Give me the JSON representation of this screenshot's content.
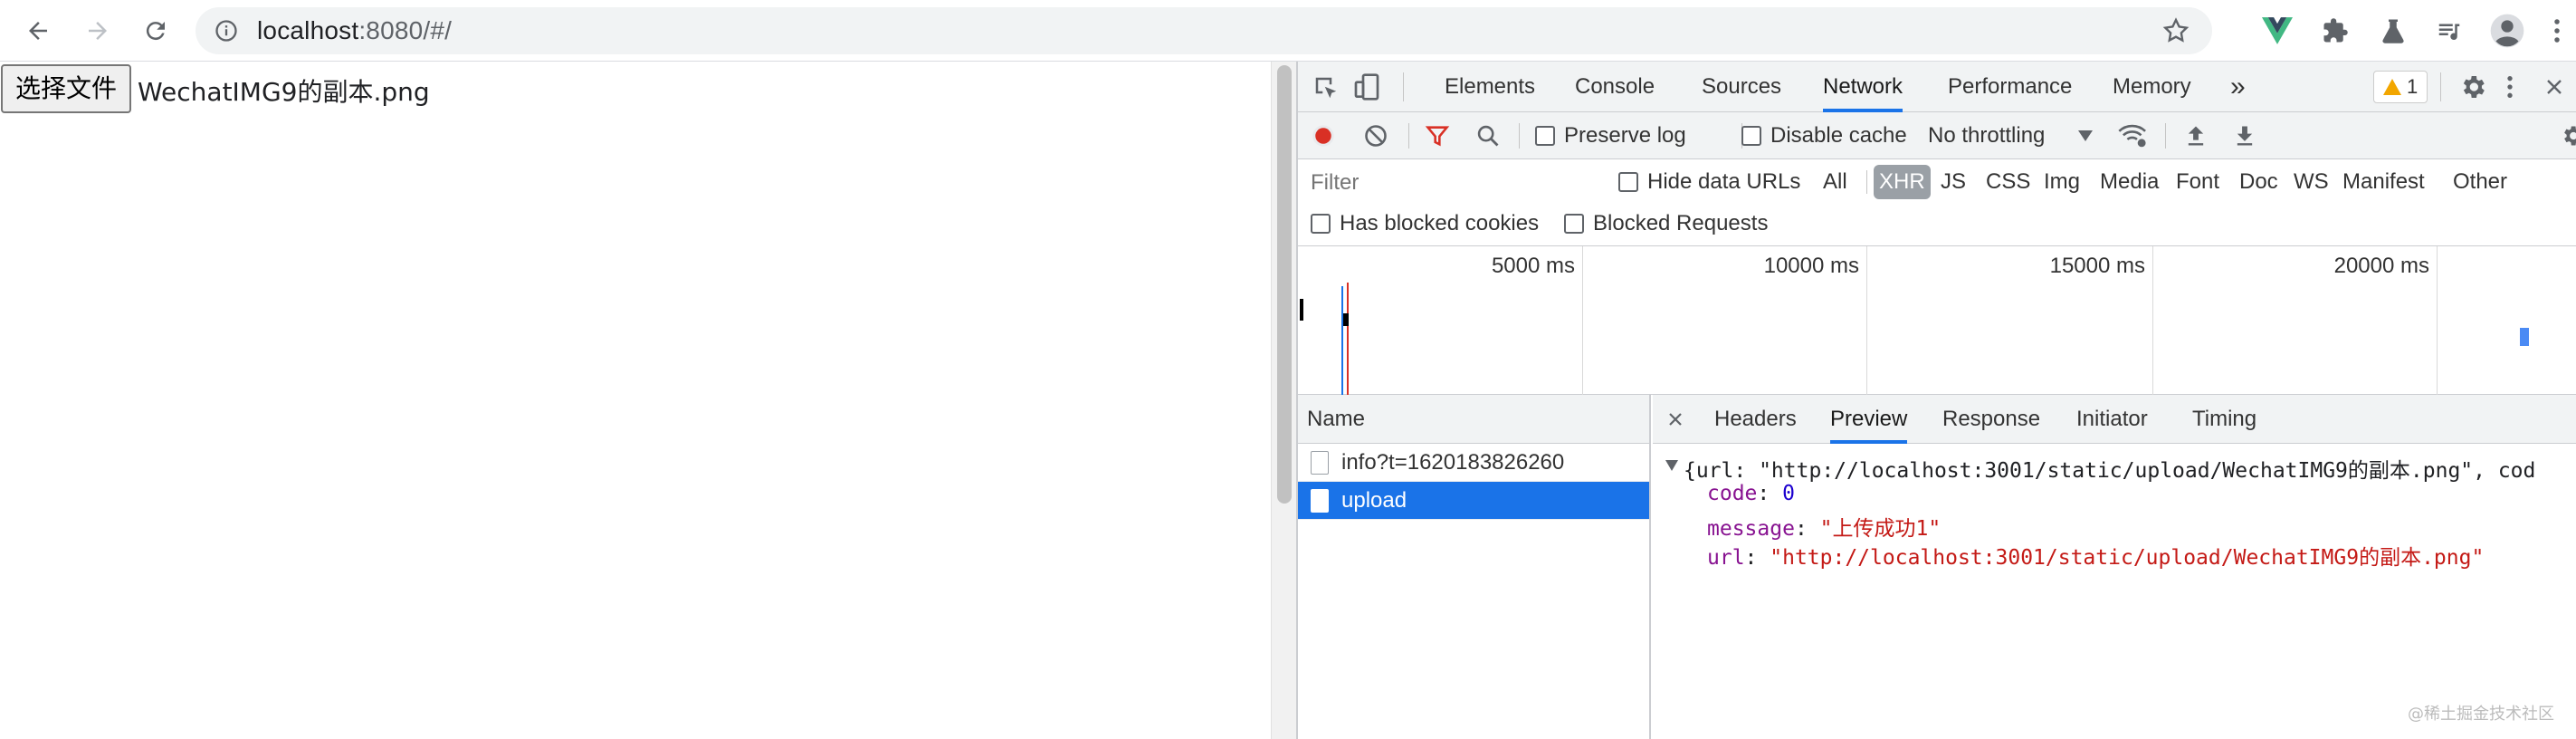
{
  "browser": {
    "url_host": "localhost",
    "url_rest": ":8080/#/"
  },
  "page": {
    "choose_file_label": "选择文件",
    "file_name": "WechatIMG9的副本.png"
  },
  "devtools": {
    "tabs": [
      "Elements",
      "Console",
      "Sources",
      "Network",
      "Performance",
      "Memory"
    ],
    "more_tabs_label": "»",
    "warning_count": "1",
    "toolbar": {
      "preserve_log": "Preserve log",
      "disable_cache": "Disable cache",
      "throttling": "No throttling"
    },
    "filter": {
      "placeholder": "Filter",
      "hide_data_urls": "Hide data URLs",
      "types": [
        "All",
        "XHR",
        "JS",
        "CSS",
        "Img",
        "Media",
        "Font",
        "Doc",
        "WS",
        "Manifest",
        "Other"
      ],
      "active_type": "XHR",
      "has_blocked_cookies": "Has blocked cookies",
      "blocked_requests": "Blocked Requests"
    },
    "overview_ticks": [
      "5000 ms",
      "10000 ms",
      "15000 ms",
      "20000 ms"
    ],
    "name_header": "Name",
    "requests": [
      {
        "name": "info?t=1620183826260",
        "selected": false
      },
      {
        "name": "upload",
        "selected": true
      }
    ],
    "detail_tabs": [
      "Headers",
      "Preview",
      "Response",
      "Initiator",
      "Timing"
    ],
    "active_detail_tab": "Preview",
    "preview": {
      "summary": "{url: \"http://localhost:3001/static/upload/WechatIMG9的副本.png\", cod",
      "code_key": "code",
      "code_value": "0",
      "message_key": "message",
      "message_value": "\"上传成功1\"",
      "url_key": "url",
      "url_value": "\"http://localhost:3001/static/upload/WechatIMG9的副本.png\""
    },
    "accent_color": "#1a73e8"
  },
  "watermark": "@稀土掘金技术社区"
}
